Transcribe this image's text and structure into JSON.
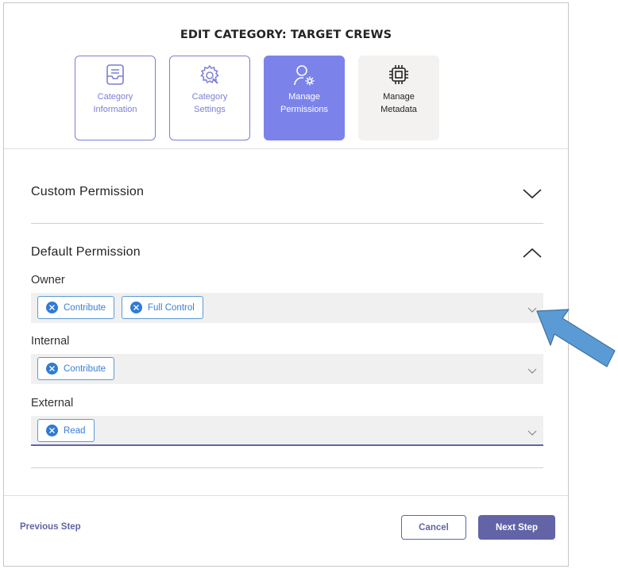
{
  "dialog": {
    "title": "EDIT CATEGORY: TARGET CREWS"
  },
  "steps": [
    {
      "label": "Category\nInformation",
      "icon": "inbox-icon",
      "state": "outlined"
    },
    {
      "label": "Category\nSettings",
      "icon": "settings-wrench-icon",
      "state": "outlined"
    },
    {
      "label": "Manage\nPermissions",
      "icon": "person-gear-icon",
      "state": "active"
    },
    {
      "label": "Manage\nMetadata",
      "icon": "chip-icon",
      "state": "plain"
    }
  ],
  "sections": {
    "custom": {
      "title": "Custom Permission",
      "expanded": false
    },
    "default": {
      "title": "Default Permission",
      "expanded": true,
      "fields": [
        {
          "label": "Owner",
          "tags": [
            "Contribute",
            "Full Control"
          ]
        },
        {
          "label": "Internal",
          "tags": [
            "Contribute"
          ]
        },
        {
          "label": "External",
          "tags": [
            "Read"
          ]
        }
      ]
    }
  },
  "footer": {
    "previous": "Previous Step",
    "cancel": "Cancel",
    "next": "Next Step"
  },
  "colors": {
    "accent": "#6264a7",
    "step_active": "#7b83eb",
    "tag_blue": "#2f7ad6",
    "annotation_arrow": "#5b9bd5"
  }
}
